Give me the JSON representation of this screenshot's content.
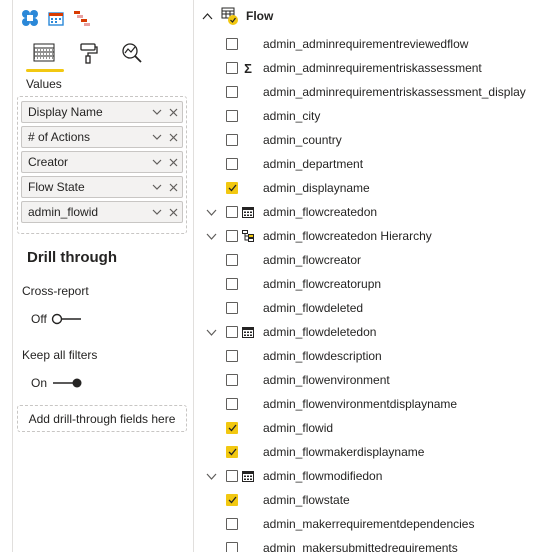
{
  "left_pane": {
    "values_label": "Values",
    "value_fields": [
      "Display Name",
      "# of Actions",
      "Creator",
      "Flow State",
      "admin_flowid"
    ],
    "drill_through_title": "Drill through",
    "cross_report_label": "Cross-report",
    "cross_report_state": "Off",
    "keep_filters_label": "Keep all filters",
    "keep_filters_state": "On",
    "drill_target_text": "Add drill-through fields here"
  },
  "fields_pane": {
    "table_name": "Flow",
    "fields": [
      {
        "name": "admin_adminrequirementreviewedflow",
        "checked": false,
        "icon": "",
        "expandable": false
      },
      {
        "name": "admin_adminrequirementriskassessment",
        "checked": false,
        "icon": "sigma-icon",
        "expandable": false
      },
      {
        "name": "admin_adminrequirementriskassessment_display",
        "checked": false,
        "icon": "",
        "expandable": false
      },
      {
        "name": "admin_city",
        "checked": false,
        "icon": "",
        "expandable": false
      },
      {
        "name": "admin_country",
        "checked": false,
        "icon": "",
        "expandable": false
      },
      {
        "name": "admin_department",
        "checked": false,
        "icon": "",
        "expandable": false
      },
      {
        "name": "admin_displayname",
        "checked": true,
        "icon": "",
        "expandable": false
      },
      {
        "name": "admin_flowcreatedon",
        "checked": false,
        "icon": "calendar-icon",
        "expandable": true
      },
      {
        "name": "admin_flowcreatedon Hierarchy",
        "checked": false,
        "icon": "hierarchy-icon",
        "expandable": true
      },
      {
        "name": "admin_flowcreator",
        "checked": false,
        "icon": "",
        "expandable": false
      },
      {
        "name": "admin_flowcreatorupn",
        "checked": false,
        "icon": "",
        "expandable": false
      },
      {
        "name": "admin_flowdeleted",
        "checked": false,
        "icon": "",
        "expandable": false
      },
      {
        "name": "admin_flowdeletedon",
        "checked": false,
        "icon": "calendar-icon",
        "expandable": true
      },
      {
        "name": "admin_flowdescription",
        "checked": false,
        "icon": "",
        "expandable": false
      },
      {
        "name": "admin_flowenvironment",
        "checked": false,
        "icon": "",
        "expandable": false
      },
      {
        "name": "admin_flowenvironmentdisplayname",
        "checked": false,
        "icon": "",
        "expandable": false
      },
      {
        "name": "admin_flowid",
        "checked": true,
        "icon": "",
        "expandable": false
      },
      {
        "name": "admin_flowmakerdisplayname",
        "checked": true,
        "icon": "",
        "expandable": false
      },
      {
        "name": "admin_flowmodifiedon",
        "checked": false,
        "icon": "calendar-icon",
        "expandable": true
      },
      {
        "name": "admin_flowstate",
        "checked": true,
        "icon": "",
        "expandable": false
      },
      {
        "name": "admin_makerrequirementdependencies",
        "checked": false,
        "icon": "",
        "expandable": false
      },
      {
        "name": "admin_makersubmittedrequirements",
        "checked": false,
        "icon": "",
        "expandable": false
      }
    ]
  },
  "colors": {
    "accent": "#f2c811",
    "border": "#c8c6c4",
    "text": "#252423"
  }
}
